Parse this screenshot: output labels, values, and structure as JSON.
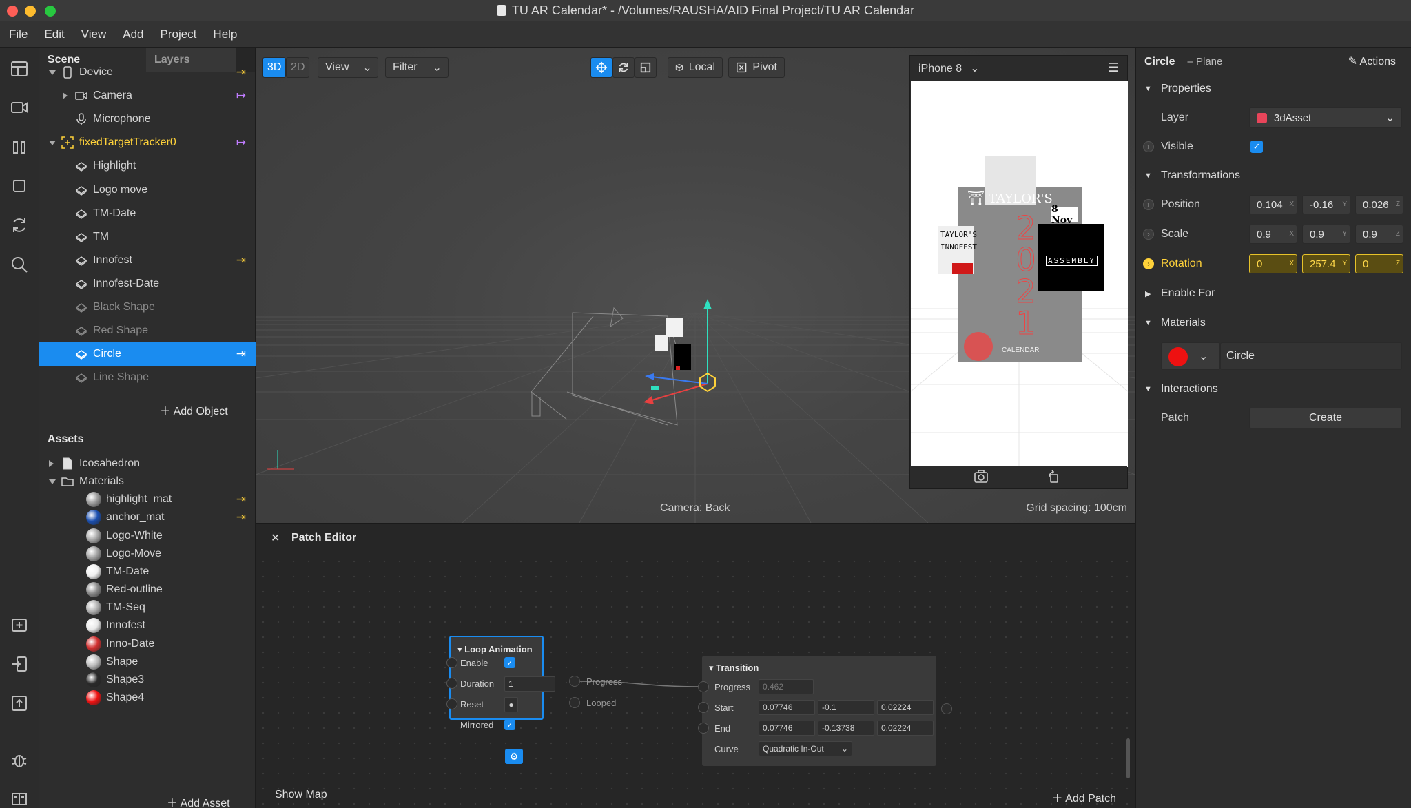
{
  "window": {
    "title": "TU AR Calendar* - /Volumes/RAUSHA/AID Final Project/TU AR Calendar"
  },
  "menu": [
    "File",
    "Edit",
    "View",
    "Add",
    "Project",
    "Help"
  ],
  "scene_panel": {
    "tabs": [
      "Scene",
      "Layers"
    ],
    "tree": [
      {
        "label": "Device",
        "indent": 0,
        "icon": "device-icon",
        "arrow": "down",
        "bind": "yellow"
      },
      {
        "label": "Camera",
        "indent": 1,
        "icon": "camera-icon",
        "arrow": "right",
        "bind": "purple"
      },
      {
        "label": "Microphone",
        "indent": 1,
        "icon": "microphone-icon",
        "arrow": "none",
        "bind": "none"
      },
      {
        "label": "fixedTargetTracker0",
        "indent": 0,
        "icon": "tracker-icon",
        "arrow": "down",
        "bind": "purple",
        "accent": true
      },
      {
        "label": "Highlight",
        "indent": 1,
        "icon": "plane-icon",
        "arrow": "none",
        "bind": "none"
      },
      {
        "label": "Logo move",
        "indent": 1,
        "icon": "plane-icon",
        "arrow": "none",
        "bind": "none"
      },
      {
        "label": "TM-Date",
        "indent": 1,
        "icon": "plane-icon",
        "arrow": "none",
        "bind": "none"
      },
      {
        "label": "TM",
        "indent": 1,
        "icon": "plane-icon",
        "arrow": "none",
        "bind": "none"
      },
      {
        "label": "Innofest",
        "indent": 1,
        "icon": "plane-icon",
        "arrow": "none",
        "bind": "yellow"
      },
      {
        "label": "Innofest-Date",
        "indent": 1,
        "icon": "plane-icon",
        "arrow": "none",
        "bind": "none"
      },
      {
        "label": "Black Shape",
        "indent": 1,
        "icon": "plane-icon",
        "arrow": "none",
        "bind": "none",
        "dim": true
      },
      {
        "label": "Red Shape",
        "indent": 1,
        "icon": "plane-icon",
        "arrow": "none",
        "bind": "none",
        "dim": true
      },
      {
        "label": "Circle",
        "indent": 1,
        "icon": "plane-icon",
        "arrow": "none",
        "bind": "white",
        "selected": true
      },
      {
        "label": "Line Shape",
        "indent": 1,
        "icon": "plane-icon",
        "arrow": "none",
        "bind": "none",
        "dim": true
      }
    ],
    "add_object": "Add Object"
  },
  "assets_panel": {
    "title": "Assets",
    "items": [
      {
        "label": "Icosahedron",
        "type": "file",
        "arrow": "right",
        "indent": 0
      },
      {
        "label": "Materials",
        "type": "folder",
        "arrow": "down",
        "indent": 0
      },
      {
        "label": "highlight_mat",
        "type": "ball",
        "color": "#9a9a9a",
        "indent": 1,
        "bind": true
      },
      {
        "label": "anchor_mat",
        "type": "ball",
        "color": "#1a4fb0",
        "indent": 1,
        "bind": true
      },
      {
        "label": "Logo-White",
        "type": "ball",
        "color": "#a8a8a8",
        "indent": 1
      },
      {
        "label": "Logo-Move",
        "type": "ball",
        "color": "#a0a0a0",
        "indent": 1
      },
      {
        "label": "TM-Date",
        "type": "ball",
        "color": "#f0f0f0",
        "indent": 1
      },
      {
        "label": "Red-outline",
        "type": "ball",
        "color": "#8a8a8a",
        "indent": 1
      },
      {
        "label": "TM-Seq",
        "type": "ball",
        "color": "#b0b0b0",
        "indent": 1
      },
      {
        "label": "Innofest",
        "type": "ball",
        "color": "#e8e8e8",
        "indent": 1
      },
      {
        "label": "Inno-Date",
        "type": "ball",
        "color": "#d23030",
        "indent": 1
      },
      {
        "label": "Shape",
        "type": "ball",
        "color": "#bdbdbd",
        "indent": 1
      },
      {
        "label": "Shape3",
        "type": "ball",
        "color": "#2a2a2a",
        "indent": 1
      },
      {
        "label": "Shape4",
        "type": "ball",
        "color": "#ee1111",
        "indent": 1
      }
    ],
    "add_asset": "Add Asset"
  },
  "viewport": {
    "mode_3d": "3D",
    "mode_2d": "2D",
    "view_menu": "View",
    "filter_menu": "Filter",
    "local_label": "Local",
    "pivot_label": "Pivot",
    "camera_label": "Camera: Back",
    "grid_label": "Grid spacing: 100cm"
  },
  "simulator": {
    "device": "iPhone 8",
    "poster": {
      "brand": "TAYLOR'S",
      "year_digits": [
        "2",
        "0",
        "2",
        "1"
      ],
      "calendar": "CALENDAR",
      "date_badge": "8 Nov",
      "innofest_line1": "TAYLOR'S",
      "innofest_line2": "INNOFEST",
      "assembly": "ASSEMBLY"
    }
  },
  "patch_editor": {
    "title": "Patch Editor",
    "show_map": "Show Map",
    "add_patch": "Add Patch",
    "loop_node": {
      "title": "Loop Animation",
      "enable": "Enable",
      "duration": "Duration",
      "duration_value": "1",
      "reset": "Reset",
      "mirrored": "Mirrored",
      "out_progress": "Progress",
      "out_looped": "Looped"
    },
    "transition_node": {
      "title": "Transition",
      "progress": "Progress",
      "progress_value": "0.462",
      "start": "Start",
      "start_values": [
        "0.07746",
        "-0.1",
        "0.02224"
      ],
      "end": "End",
      "end_values": [
        "0.07746",
        "-0.13738",
        "0.02224"
      ],
      "curve": "Curve",
      "curve_value": "Quadratic In-Out"
    }
  },
  "inspector": {
    "object_name": "Circle",
    "object_type": "– Plane",
    "actions": "Actions",
    "properties": "Properties",
    "layer_label": "Layer",
    "layer_value": "3dAsset",
    "layer_color": "#e8455a",
    "visible_label": "Visible",
    "transformations": "Transformations",
    "position_label": "Position",
    "position": [
      "0.104",
      "-0.16",
      "0.026"
    ],
    "scale_label": "Scale",
    "scale": [
      "0.9",
      "0.9",
      "0.9"
    ],
    "rotation_label": "Rotation",
    "rotation": [
      "0",
      "257.4",
      "0"
    ],
    "axes": [
      "X",
      "Y",
      "Z"
    ],
    "enable_for": "Enable For",
    "materials": "Materials",
    "material_name": "Circle",
    "material_color": "#ee1111",
    "interactions": "Interactions",
    "patch_label": "Patch",
    "create_button": "Create"
  },
  "colors": {
    "accent": "#1a8cf0",
    "highlight": "#ffd23a"
  }
}
